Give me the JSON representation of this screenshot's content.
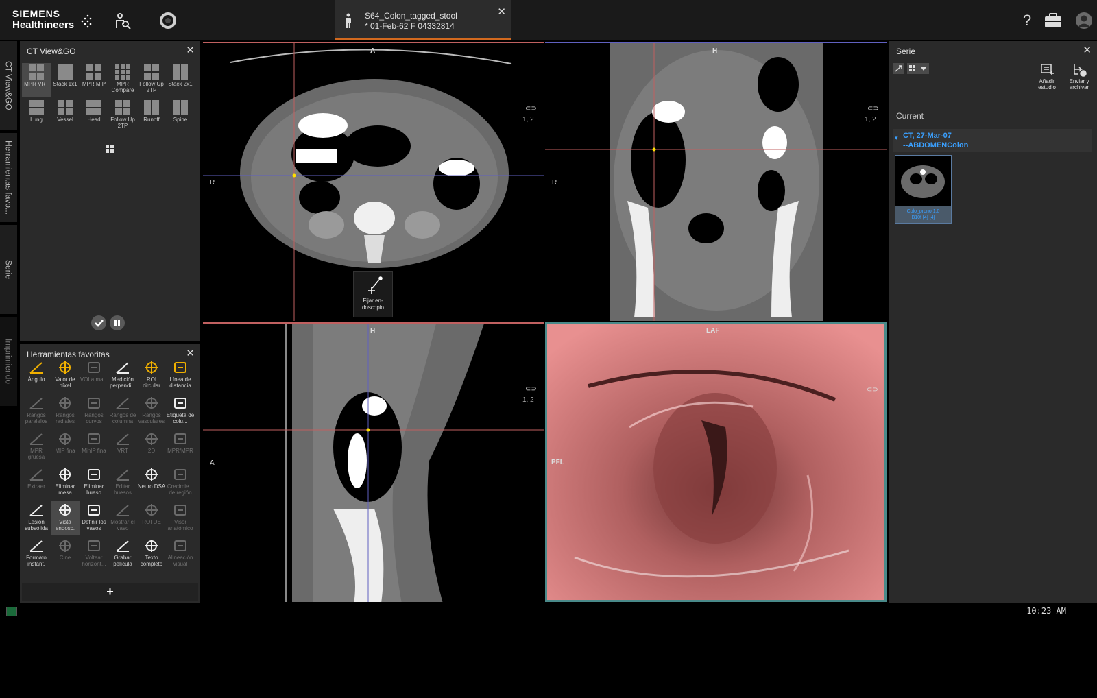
{
  "app": {
    "brand_line1": "SIEMENS",
    "brand_line2": "Healthineers"
  },
  "patient_tab": {
    "name": "S64_Colon_tagged_stool",
    "info": "* 01-Feb-62 F 04332814"
  },
  "top_right": {
    "help_label": "?"
  },
  "vertical_tabs": [
    {
      "label": "CT View&GO"
    },
    {
      "label": "Herramientas favo..."
    },
    {
      "label": "Serie"
    },
    {
      "label": "Imprimiendo"
    }
  ],
  "layout_panel": {
    "title": "CT View&GO",
    "items": [
      {
        "label": "MPR VRT",
        "active": true
      },
      {
        "label": "Stack 1x1"
      },
      {
        "label": "MPR MIP"
      },
      {
        "label": "MPR Compare"
      },
      {
        "label": "Follow Up 2TP"
      },
      {
        "label": "Stack 2x1"
      },
      {
        "label": "Lung"
      },
      {
        "label": "Vessel"
      },
      {
        "label": "Head"
      },
      {
        "label": "Follow Up 2TP"
      },
      {
        "label": "Runoff"
      },
      {
        "label": "Spine"
      }
    ]
  },
  "tools_panel": {
    "title": "Herramientas favoritas",
    "tools": [
      {
        "label": "Ángulo",
        "icon": "angle-icon",
        "dim": false
      },
      {
        "label": "Valor de píxel",
        "icon": "pixel-value-icon",
        "dim": false
      },
      {
        "label": "VOI a ma...",
        "icon": "voi-icon",
        "dim": true
      },
      {
        "label": "Medición perpendi...",
        "icon": "perpendicular-measure-icon",
        "dim": false
      },
      {
        "label": "ROI circular",
        "icon": "circle-roi-icon",
        "dim": false
      },
      {
        "label": "Línea de distancia",
        "icon": "ruler-icon",
        "dim": false
      },
      {
        "label": "Rangos paralelos",
        "icon": "parallel-ranges-icon",
        "dim": true
      },
      {
        "label": "Rangos radiales",
        "icon": "radial-ranges-icon",
        "dim": true
      },
      {
        "label": "Rangos curvos",
        "icon": "curved-ranges-icon",
        "dim": true
      },
      {
        "label": "Rangos de columna",
        "icon": "spine-ranges-icon",
        "dim": true
      },
      {
        "label": "Rangos vasculares",
        "icon": "vascular-ranges-icon",
        "dim": true
      },
      {
        "label": "Etiqueta de colu...",
        "icon": "spine-label-icon",
        "dim": false
      },
      {
        "label": "MPR gruesa",
        "icon": "thick-mpr-icon",
        "dim": true
      },
      {
        "label": "MIP fina",
        "icon": "thin-mip-icon",
        "dim": true
      },
      {
        "label": "MinIP fina",
        "icon": "thin-minip-icon",
        "dim": true
      },
      {
        "label": "VRT",
        "icon": "vrt-icon",
        "dim": true
      },
      {
        "label": "2D",
        "icon": "2d-icon",
        "dim": true
      },
      {
        "label": "MPR/MPR",
        "icon": "mpr-mpr-icon",
        "dim": true
      },
      {
        "label": "Extraer",
        "icon": "extract-icon",
        "dim": true
      },
      {
        "label": "Eliminar mesa",
        "icon": "remove-table-icon",
        "dim": false
      },
      {
        "label": "Eliminar hueso",
        "icon": "remove-bone-icon",
        "dim": false
      },
      {
        "label": "Editar huesos",
        "icon": "edit-bone-icon",
        "dim": true
      },
      {
        "label": "Neuro DSA",
        "icon": "neuro-dsa-icon",
        "dim": false
      },
      {
        "label": "Crecimie... de región",
        "icon": "region-grow-icon",
        "dim": true
      },
      {
        "label": "Lesión subsólida",
        "icon": "lung-lesion-icon",
        "dim": false
      },
      {
        "label": "Vista endosc.",
        "icon": "endoscopic-view-icon",
        "dim": false,
        "active": true
      },
      {
        "label": "Definir los vasos",
        "icon": "define-vessels-icon",
        "dim": false
      },
      {
        "label": "Mostrar el vaso",
        "icon": "show-vessel-icon",
        "dim": true
      },
      {
        "label": "ROI DE",
        "icon": "roi-de-icon",
        "dim": true
      },
      {
        "label": "Visor anatómico",
        "icon": "anatomic-viewer-icon",
        "dim": true
      },
      {
        "label": "Formato instant.",
        "icon": "layout-snapshot-icon",
        "dim": false
      },
      {
        "label": "Cine",
        "icon": "cine-icon",
        "dim": true
      },
      {
        "label": "Voltear horizont...",
        "icon": "flip-horizontal-icon",
        "dim": true
      },
      {
        "label": "Grabar película",
        "icon": "record-film-icon",
        "dim": false
      },
      {
        "label": "Texto completo",
        "icon": "full-text-icon",
        "dim": false
      },
      {
        "label": "Alineación visual",
        "icon": "visual-alignment-icon",
        "dim": true
      }
    ],
    "add_label": "+"
  },
  "viewports": {
    "axial": {
      "top": "A",
      "left": "R",
      "index": "1, 2"
    },
    "coronal": {
      "top": "H",
      "left": "R",
      "index": "1, 2"
    },
    "sagittal": {
      "top": "H",
      "left": "A",
      "index": "1, 2"
    },
    "vrt": {
      "top": "LAF",
      "left": "PFL"
    }
  },
  "endoscope_popup": {
    "label": "Fijar en-doscopio"
  },
  "series_panel": {
    "title": "Serie",
    "add_study_label": "Añadir estudio",
    "send_archive_label": "Enviar y archivar",
    "current_label": "Current",
    "study_line1": "CT, 27-Mar-07",
    "study_line2": "--ABDOMENColon",
    "thumb_line1": "Colo_prono 1.0",
    "thumb_line2": "B10f [4] [4]"
  },
  "status": {
    "time": "10:23 AM"
  }
}
